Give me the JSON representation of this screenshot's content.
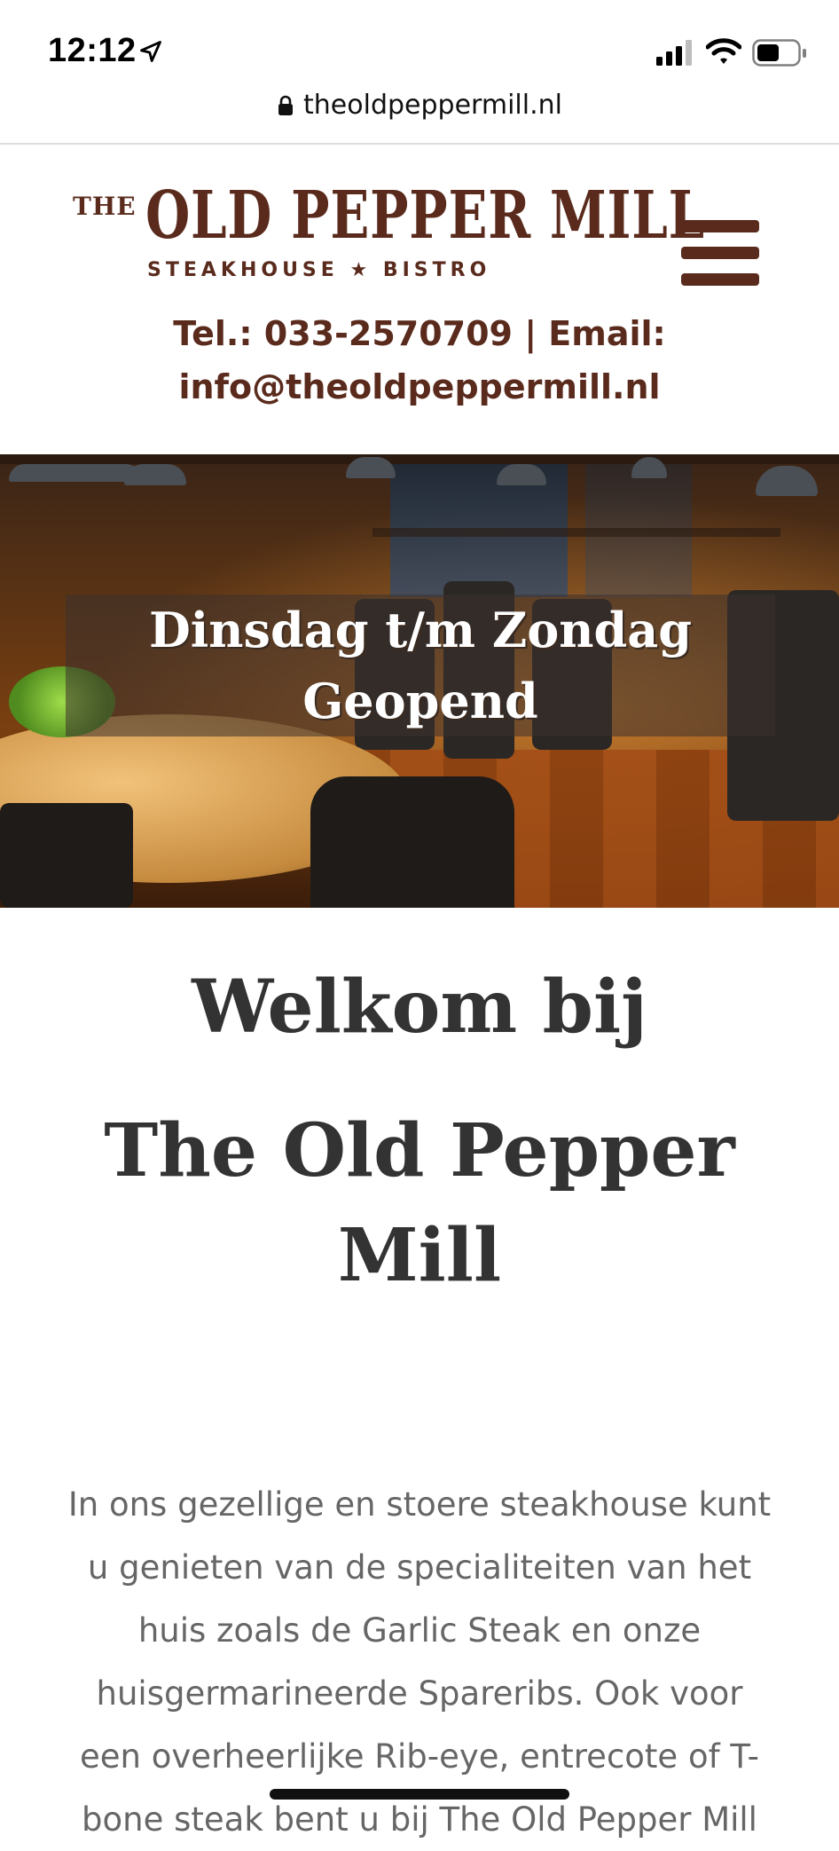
{
  "status_bar": {
    "time": "12:12",
    "location_icon": "location-arrow-icon",
    "signal_icon": "cellular-signal-icon",
    "wifi_icon": "wifi-icon",
    "battery_icon": "battery-icon",
    "battery_level": 0.55
  },
  "browser": {
    "lock_icon": "lock-icon",
    "url": "theoldpeppermill.nl"
  },
  "header": {
    "logo_the": "THE",
    "logo_main": "OLD PEPPER MILL",
    "logo_sub": "STEAKHOUSE ★ BISTRO",
    "menu_icon": "hamburger-menu-icon",
    "contact_line1": "Tel.: 033-2570709 | Email:",
    "contact_line2": "info@theoldpeppermill.nl",
    "brand_color": "#5a2b1d"
  },
  "hero": {
    "title_line1": "Dinsdag t/m Zondag",
    "title_line2": "Geopend"
  },
  "welcome": {
    "line1": "Welkom bij",
    "line2": "The Old Pepper Mill"
  },
  "intro": {
    "text": "In ons gezellige en stoere steakhouse kunt u genieten van de specialiteiten van het huis zoals de Garlic Steak en onze huisgermarineerde Spareribs. Ook voor een overheerlijke  Rib-eye, entrecote of T-bone steak bent u bij The Old Pepper Mill"
  }
}
